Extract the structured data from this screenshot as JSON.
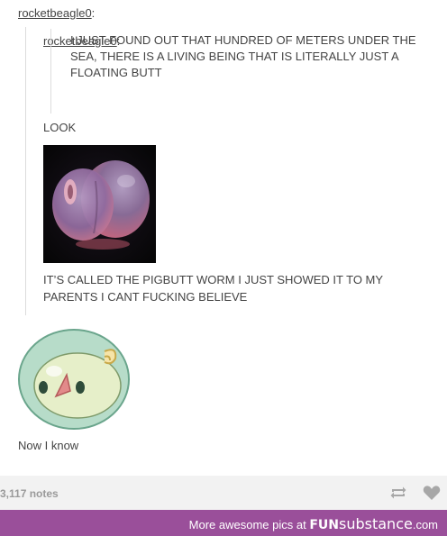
{
  "post": {
    "username": "rocketbeagle0",
    "username_suffix": ":",
    "reblog": {
      "username": "rocketbeagle0",
      "username_suffix": ":",
      "quote_text": "I JUST FOUND OUT THAT HUNDRED OF METERS UNDER THE SEA, THERE IS A LIVING BEING THAT IS LITERALLY JUST A FLOATING BUTT",
      "look_text": "LOOK",
      "caption": "IT’S CALLED THE PIGBUTT WORM I JUST SHOWED IT TO MY PARENTS I CANT FUCKING BELIEVE"
    },
    "reply_text": "Now I know"
  },
  "footer": {
    "notes": "3,117 notes",
    "reblog_icon": "reblog-icon",
    "like_icon": "heart-icon"
  },
  "banner": {
    "text": "More awesome pics at",
    "brand_fun": "FUN",
    "brand_sub": "substance",
    "brand_domain": ".com",
    "color": "#9a4f9a"
  }
}
